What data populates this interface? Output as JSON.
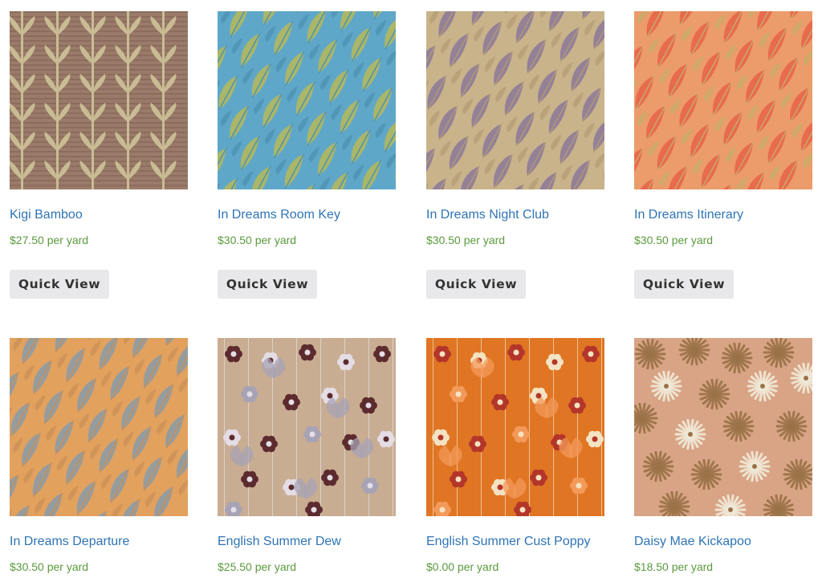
{
  "products": [
    {
      "title": "Kigi Bamboo",
      "price": "$27.50 per yard",
      "button": "Quick View",
      "swatch": "kigi-bamboo-pattern",
      "colors": {
        "bg": "#9a7b6a",
        "a": "#c9bc94",
        "b": "#7e5d4e"
      }
    },
    {
      "title": "In Dreams Room Key",
      "price": "$30.50 per yard",
      "button": "Quick View",
      "swatch": "leaf-pattern",
      "colors": {
        "bg": "#5fa7c9",
        "a": "#b3b85d",
        "b": "#4a8fb0"
      }
    },
    {
      "title": "In Dreams Night Club",
      "price": "$30.50 per yard",
      "button": "Quick View",
      "swatch": "leaf-pattern",
      "colors": {
        "bg": "#c9b38a",
        "a": "#8e7a98",
        "b": "#b29b74"
      }
    },
    {
      "title": "In Dreams Itinerary",
      "price": "$30.50 per yard",
      "button": "Quick View",
      "swatch": "leaf-pattern",
      "colors": {
        "bg": "#eb9c6a",
        "a": "#e8664a",
        "b": "#c3b06a"
      }
    },
    {
      "title": "In Dreams Departure",
      "price": "$30.50 per yard",
      "button": "",
      "swatch": "leaf-pattern",
      "colors": {
        "bg": "#e3a15e",
        "a": "#8d9ba5",
        "b": "#c98f55"
      }
    },
    {
      "title": "English Summer Dew",
      "price": "$25.50 per yard",
      "button": "",
      "swatch": "flower-pattern",
      "colors": {
        "bg": "#c9ad92",
        "a": "#5c2b2e",
        "b": "#a7a3b4",
        "c": "#e4dde6"
      }
    },
    {
      "title": "English Summer Cust Poppy",
      "price": "$0.00 per yard",
      "button": "",
      "swatch": "flower-pattern",
      "colors": {
        "bg": "#e07524",
        "a": "#b4362a",
        "b": "#f39a5a",
        "c": "#f4e3c2"
      }
    },
    {
      "title": "Daisy Mae Kickapoo",
      "price": "$18.50 per yard",
      "button": "",
      "swatch": "daisy-pattern",
      "colors": {
        "bg": "#d8a485",
        "a": "#f1ead9",
        "b": "#9a7248"
      }
    }
  ]
}
